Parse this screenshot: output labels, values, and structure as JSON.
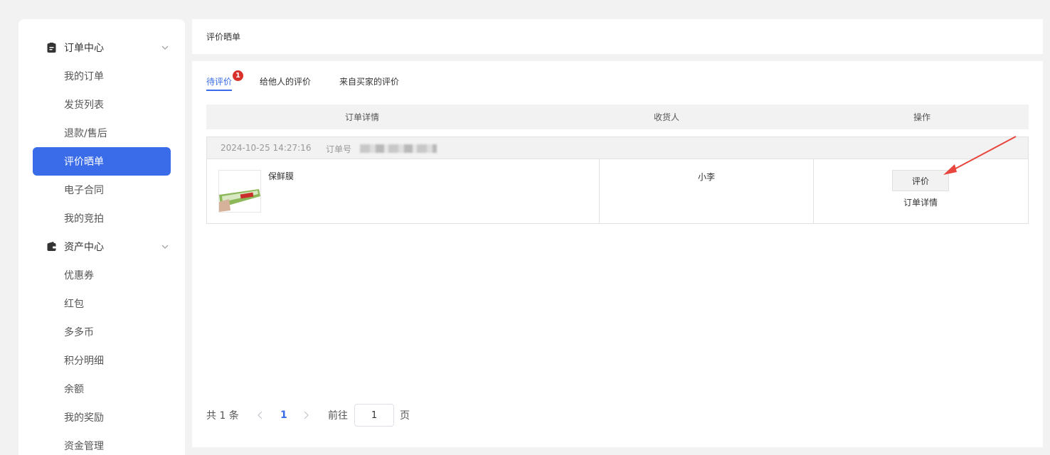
{
  "sidebar": {
    "groups": [
      {
        "label": "订单中心",
        "icon": "clipboard-icon",
        "items": [
          "我的订单",
          "发货列表",
          "退款/售后",
          "评价晒单",
          "电子合同",
          "我的竞拍"
        ]
      },
      {
        "label": "资产中心",
        "icon": "wallet-icon",
        "items": [
          "优惠券",
          "红包",
          "多多币",
          "积分明细",
          "余额",
          "我的奖励",
          "资金管理"
        ]
      }
    ],
    "active_item": "评价晒单"
  },
  "page_title": "评价晒单",
  "tabs": [
    {
      "label": "待评价",
      "badge": "1"
    },
    {
      "label": "给他人的评价"
    },
    {
      "label": "来自买家的评价"
    }
  ],
  "table": {
    "headers": [
      "订单详情",
      "收货人",
      "操作"
    ]
  },
  "orders": [
    {
      "datetime": "2024-10-25 14:27:16",
      "order_no_label": "订单号",
      "product_name": "保鲜膜",
      "receiver": "小李",
      "action_primary": "评价",
      "action_secondary": "订单详情"
    }
  ],
  "pagination": {
    "total_text": "共 1 条",
    "current_page": "1",
    "goto_label": "前往",
    "goto_value": "1",
    "page_suffix": "页"
  },
  "colors": {
    "accent": "#3a6ce9",
    "badge": "#d7312a",
    "annotation_arrow": "#e8453c"
  }
}
